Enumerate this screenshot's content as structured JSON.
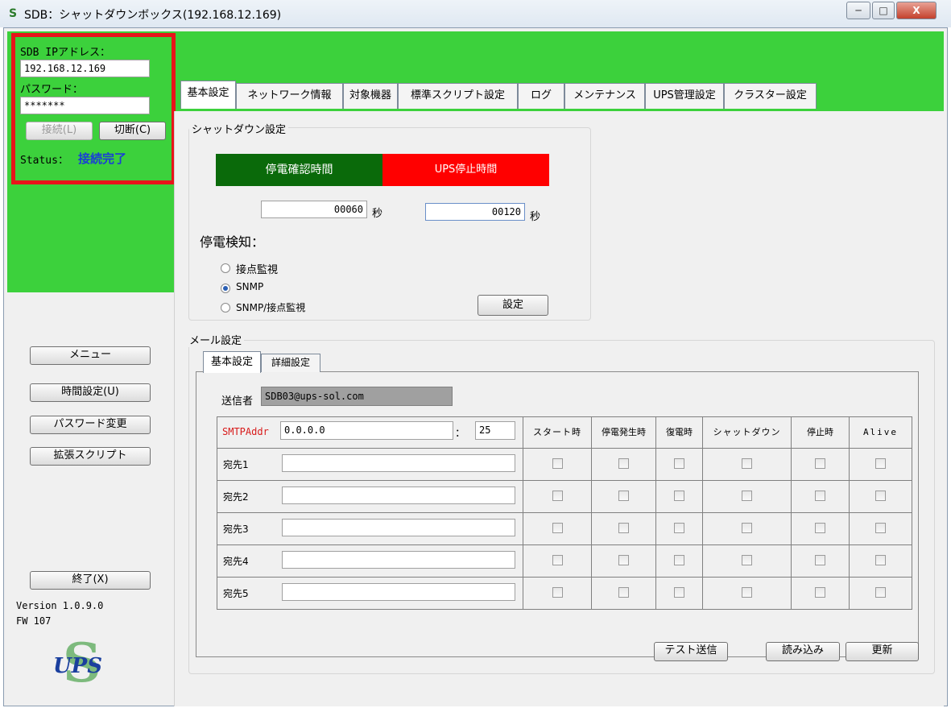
{
  "window": {
    "title": "SDB：シャットダウンボックス(192.168.12.169)",
    "icon": "S",
    "minimize": "─",
    "maximize": "□",
    "close": "X"
  },
  "login": {
    "ip_label": "SDB IPアドレス：",
    "ip_value": "192.168.12.169",
    "password_label": "パスワード：",
    "password_value": "*******",
    "connect_button": "接続(L)",
    "disconnect_button": "切断(C)",
    "status_label": "Status：",
    "status_value": "接続完了",
    "status_color": "#1a3fd6"
  },
  "sidebar": {
    "menu_button": "メニュー",
    "time_button": "時間設定(U)",
    "password_button": "パスワード変更",
    "script_button": "拡張スクリプト",
    "exit_button": "終了(X)",
    "version": "Version 1.0.9.0",
    "fw": "FW 107",
    "logo_text": "UPS",
    "logo_letter": "S"
  },
  "tabs": [
    "基本設定",
    "ネットワーク情報",
    "対象機器",
    "標準スクリプト設定",
    "ログ",
    "メンテナンス",
    "UPS管理設定",
    "クラスター設定"
  ],
  "shutdown": {
    "group_title": "シャットダウン設定",
    "outage_label": "停電確認時間",
    "outage_color": "#0a6a0a",
    "ups_stop_label": "UPS停止時間",
    "ups_stop_color": "#ff0000",
    "outage_value": "00060",
    "ups_stop_value": "00120",
    "unit": "秒",
    "detect_label": "停電検知：",
    "options": [
      "接点監視",
      "SNMP",
      "SNMP/接点監視"
    ],
    "selected": "SNMP",
    "set_button": "設定"
  },
  "mail": {
    "group_title": "メール設定",
    "tabs": [
      "基本設定",
      "詳細設定"
    ],
    "sender_label": "送信者",
    "sender_value": "SDB03@ups-sol.com",
    "smtp_label": "SMTPAddr",
    "smtp_value": "0.0.0.0",
    "colon": "：",
    "port_value": "25",
    "columns": [
      "スタート時",
      "停電発生時",
      "復電時",
      "シャットダウン",
      "停止時",
      "Alive"
    ],
    "recipients": [
      "宛先1",
      "宛先2",
      "宛先3",
      "宛先4",
      "宛先5"
    ],
    "test_button": "テスト送信",
    "read_button": "読み込み",
    "update_button": "更新"
  }
}
